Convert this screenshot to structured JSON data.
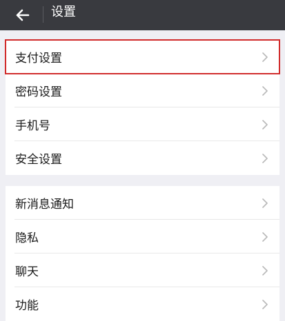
{
  "header": {
    "title": "设置",
    "back_icon": "arrow-left-icon"
  },
  "groups": [
    {
      "items": [
        {
          "label": "支付设置",
          "highlighted": true
        },
        {
          "label": "密码设置"
        },
        {
          "label": "手机号"
        },
        {
          "label": "安全设置"
        }
      ]
    },
    {
      "items": [
        {
          "label": "新消息通知"
        },
        {
          "label": "隐私"
        },
        {
          "label": "聊天"
        },
        {
          "label": "功能"
        }
      ]
    }
  ],
  "colors": {
    "header_bg": "#393a3f",
    "page_bg": "#efeff4",
    "highlight": "#d12b2b"
  }
}
